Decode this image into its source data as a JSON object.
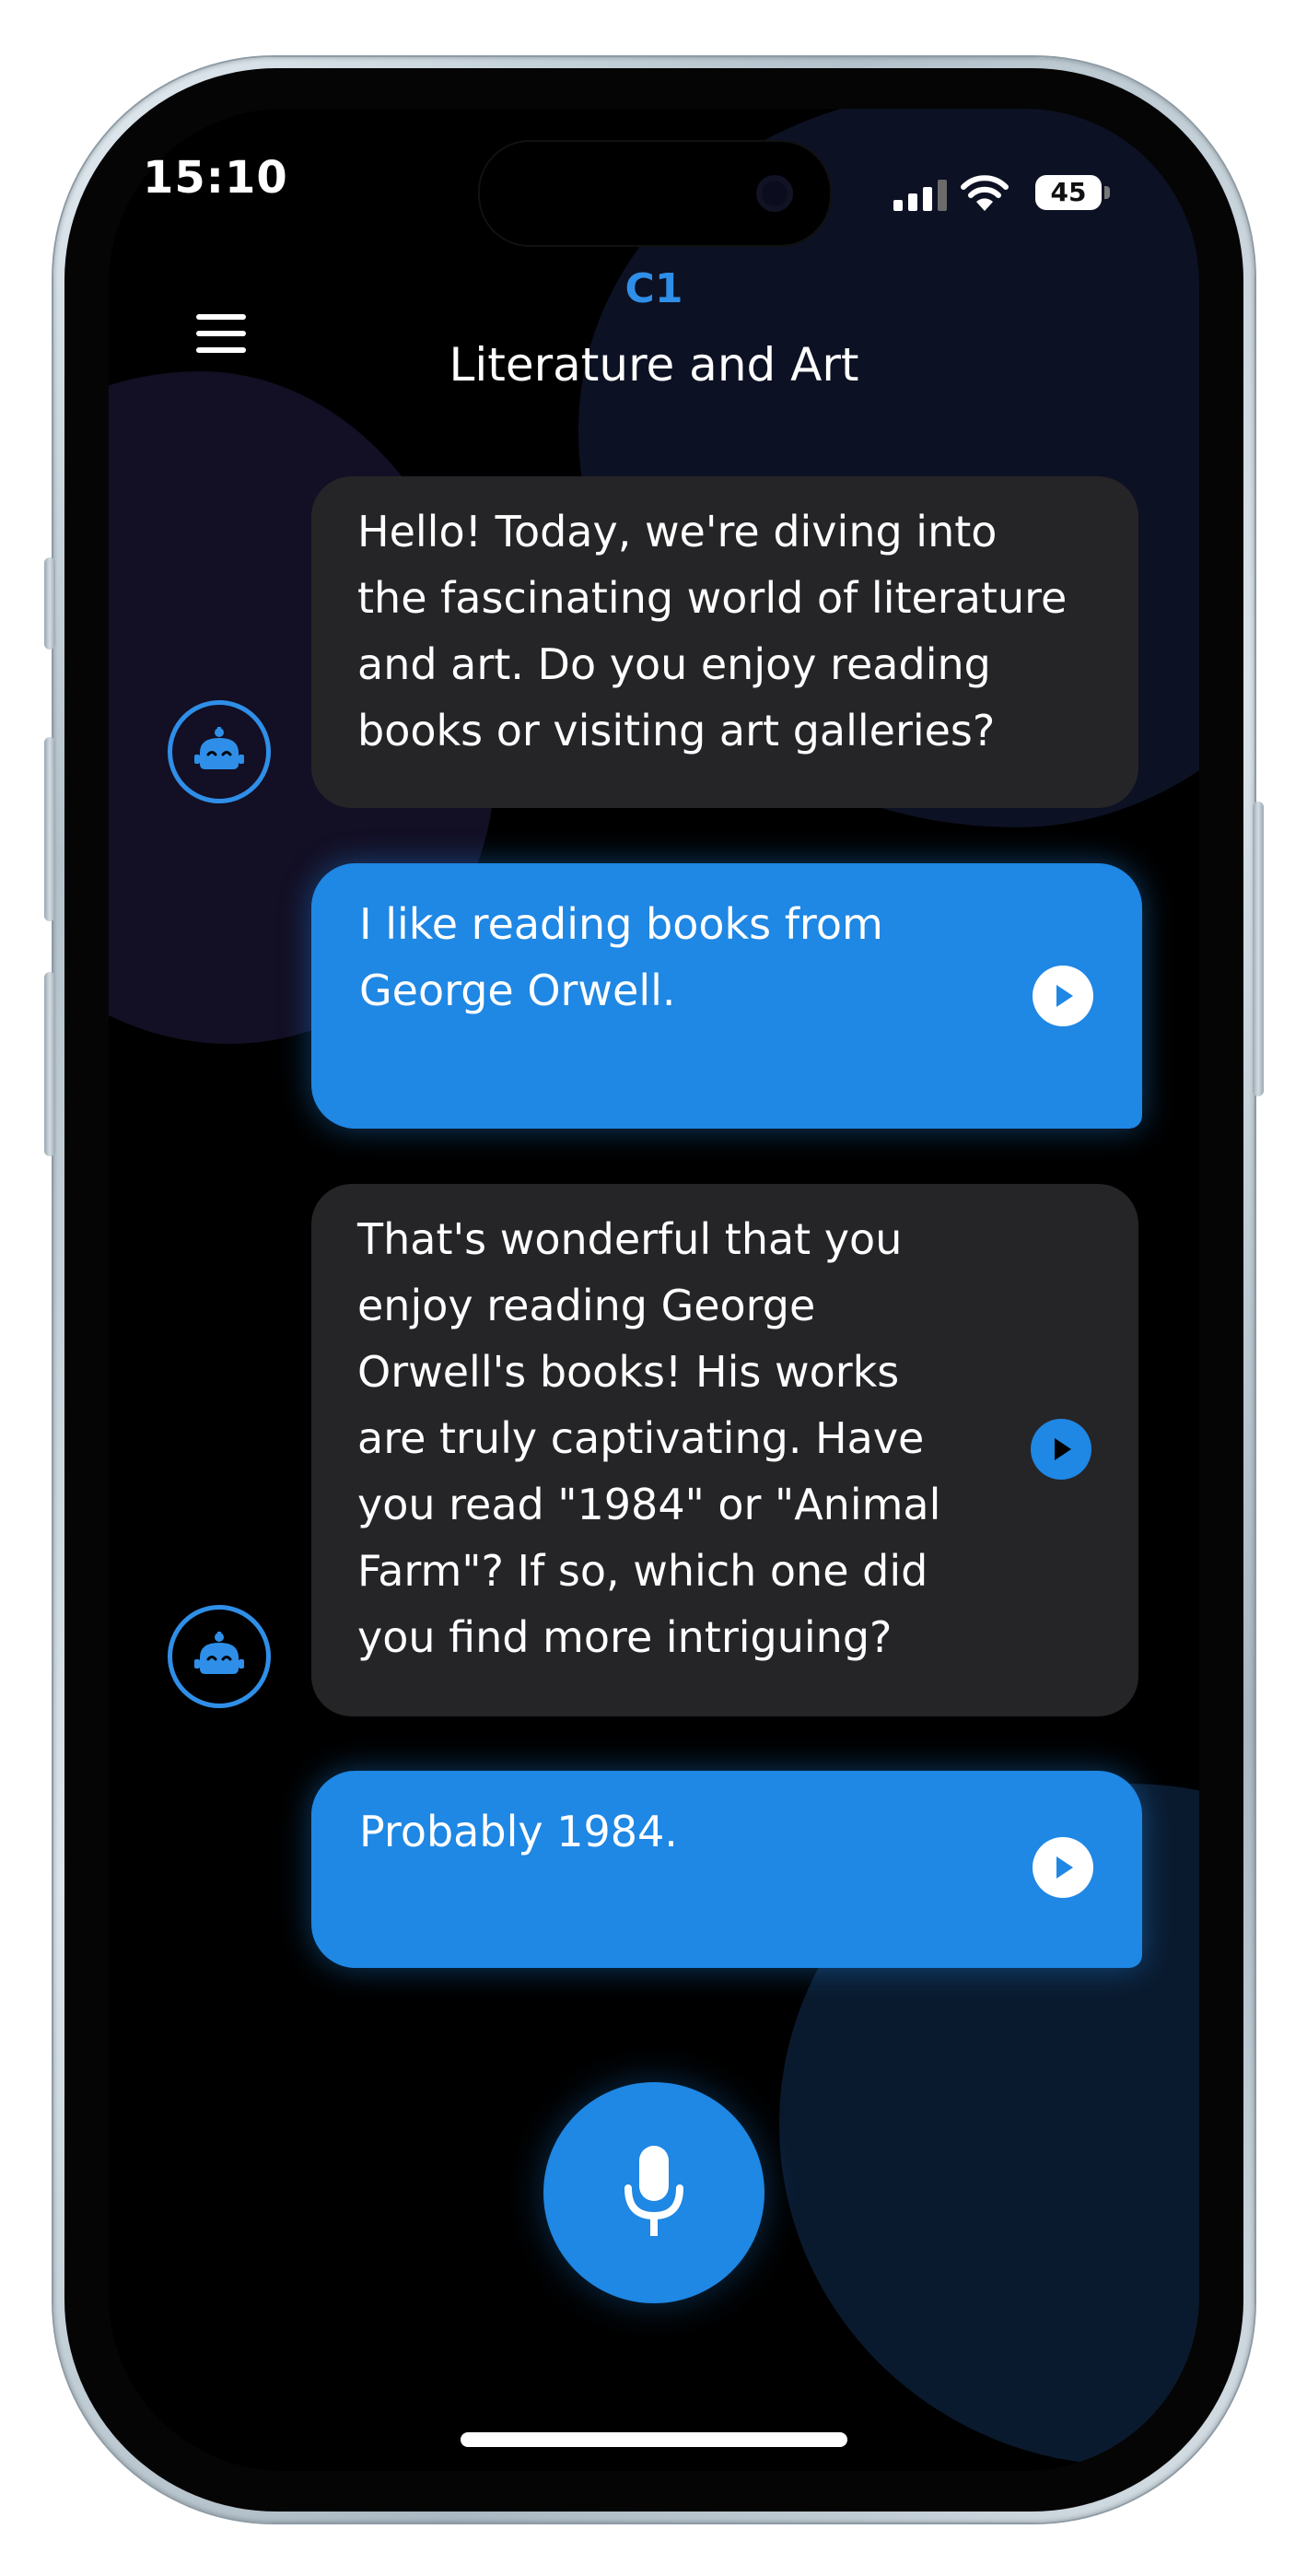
{
  "status_bar": {
    "time": "15:10",
    "battery": "45",
    "signal_icon": "cellular-signal-icon",
    "wifi_icon": "wifi-icon"
  },
  "header": {
    "menu_icon": "hamburger-menu-icon",
    "level": "C1",
    "topic": "Literature and Art"
  },
  "messages": [
    {
      "role": "bot",
      "avatar_icon": "robot-icon",
      "lines": [
        "Hello! Today, we're diving into",
        "the fascinating world of literature",
        "and art. Do you enjoy reading",
        "books or visiting art galleries?"
      ]
    },
    {
      "role": "user",
      "play_icon": "play-icon",
      "lines": [
        "I like reading books from",
        "George Orwell."
      ]
    },
    {
      "role": "bot",
      "avatar_icon": "robot-icon",
      "play_icon": "play-icon",
      "lines": [
        "That's wonderful that you",
        "enjoy reading George",
        "Orwell's books! His works",
        "are truly captivating. Have",
        "you read \"1984\" or \"Animal",
        "Farm\"? If so, which one did",
        "you find more intriguing?"
      ]
    },
    {
      "role": "user",
      "play_icon": "play-icon",
      "lines": [
        "Probably 1984."
      ]
    }
  ],
  "footer": {
    "mic_icon": "microphone-icon"
  },
  "colors": {
    "accent": "#1f87e4",
    "bot_bubble": "#252527",
    "background": "#000000"
  }
}
